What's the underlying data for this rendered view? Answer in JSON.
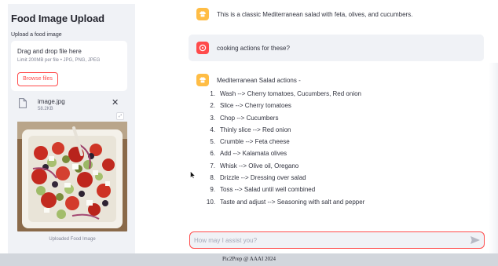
{
  "sidebar": {
    "title": "Food Image Upload",
    "upload_label": "Upload a food image",
    "dropzone": {
      "title": "Drag and drop file here",
      "limit": "Limit 200MB per file • JPG, PNG, JPEG",
      "browse_label": "Browse files"
    },
    "file": {
      "name": "image.jpg",
      "size": "58.2KB",
      "icon": "file-icon",
      "remove_icon": "close-icon"
    },
    "image_caption": "Uploaded Food Image"
  },
  "chat": {
    "messages": [
      {
        "role": "assistant",
        "icon": "chef-icon",
        "text": "This is a classic Mediterranean salad with feta, olives, and cucumbers."
      },
      {
        "role": "user",
        "icon": "user-icon",
        "text": "cooking actions for these?"
      },
      {
        "role": "assistant",
        "icon": "chef-icon",
        "text": "Mediterranean Salad actions -",
        "steps": [
          {
            "num": "1.",
            "text": "Wash --> Cherry tomatoes, Cucumbers, Red onion"
          },
          {
            "num": "2.",
            "text": "Slice --> Cherry tomatoes"
          },
          {
            "num": "3.",
            "text": "Chop --> Cucumbers"
          },
          {
            "num": "4.",
            "text": "Thinly slice --> Red onion"
          },
          {
            "num": "5.",
            "text": "Crumble --> Feta cheese"
          },
          {
            "num": "6.",
            "text": "Add --> Kalamata olives"
          },
          {
            "num": "7.",
            "text": "Whisk --> Olive oil, Oregano"
          },
          {
            "num": "8.",
            "text": "Drizzle --> Dressing over salad"
          },
          {
            "num": "9.",
            "text": "Toss --> Salad until well combined"
          },
          {
            "num": "10.",
            "text": "Taste and adjust --> Seasoning with salt and pepper"
          }
        ]
      }
    ],
    "input": {
      "placeholder": "How may I assist you?",
      "value": "",
      "send_icon": "send-icon"
    }
  },
  "footer": {
    "text": "Pic2Prep @ AAAI 2024"
  },
  "colors": {
    "accent": "#ff4b4b",
    "assistant_avatar": "#ffbd45",
    "sidebar_bg": "#f0f2f6",
    "footer_bg": "#d2d6dc"
  }
}
